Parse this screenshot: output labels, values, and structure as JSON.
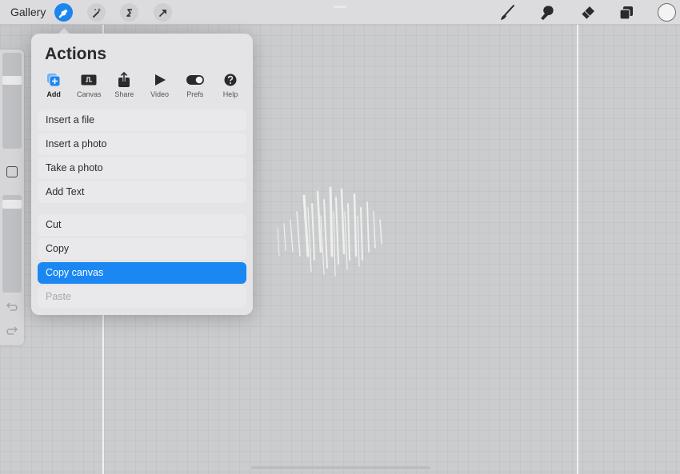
{
  "toolbar": {
    "gallery_label": "Gallery",
    "left_tools": [
      {
        "name": "actions",
        "icon": "wrench-icon",
        "active": true
      },
      {
        "name": "adjustments",
        "icon": "magic-wand-icon",
        "active": false
      },
      {
        "name": "selection",
        "icon": "selection-s-icon",
        "active": false
      },
      {
        "name": "transform",
        "icon": "arrow-cursor-icon",
        "active": false
      }
    ],
    "right_tools": [
      {
        "name": "paint",
        "icon": "brush-icon"
      },
      {
        "name": "smudge",
        "icon": "smudge-finger-icon"
      },
      {
        "name": "erase",
        "icon": "eraser-icon"
      },
      {
        "name": "layers",
        "icon": "layers-icon"
      }
    ],
    "current_color": "#f3f3f4",
    "accent_color": "#1b86f0"
  },
  "sidebar": {
    "brush_size_level": 0.73,
    "opacity_level": 0.95,
    "modify_button_icon": "square-icon",
    "undo_icon": "undo-icon",
    "redo_icon": "redo-icon"
  },
  "actions_popover": {
    "title": "Actions",
    "tabs": [
      {
        "label": "Add",
        "icon": "add-icon",
        "active": true
      },
      {
        "label": "Canvas",
        "icon": "canvas-icon",
        "active": false
      },
      {
        "label": "Share",
        "icon": "share-icon",
        "active": false
      },
      {
        "label": "Video",
        "icon": "play-icon",
        "active": false
      },
      {
        "label": "Prefs",
        "icon": "toggle-icon",
        "active": false
      },
      {
        "label": "Help",
        "icon": "help-icon",
        "active": false
      }
    ],
    "group1": [
      {
        "label": "Insert a file"
      },
      {
        "label": "Insert a photo"
      },
      {
        "label": "Take a photo"
      },
      {
        "label": "Add Text"
      }
    ],
    "group2": [
      {
        "label": "Cut",
        "state": "normal"
      },
      {
        "label": "Copy",
        "state": "normal"
      },
      {
        "label": "Copy canvas",
        "state": "selected"
      },
      {
        "label": "Paste",
        "state": "disabled"
      }
    ]
  }
}
